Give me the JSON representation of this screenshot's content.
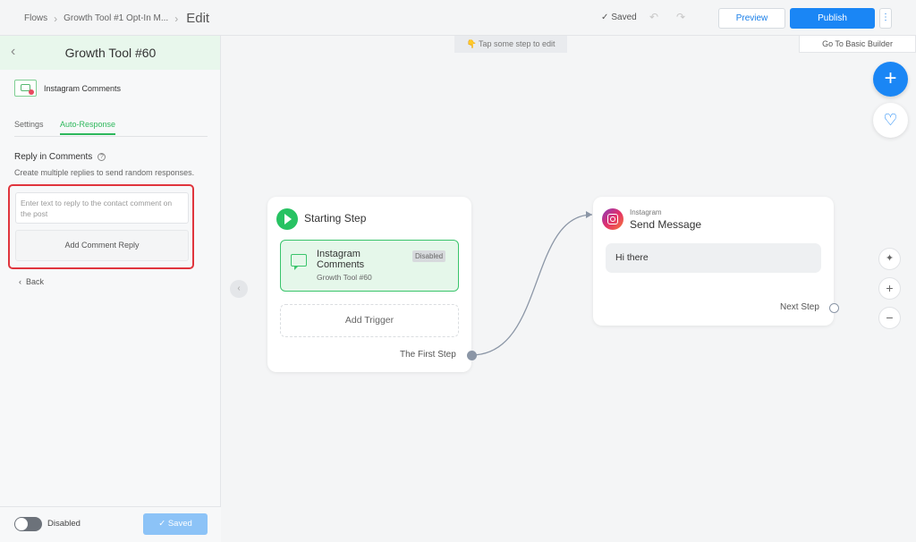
{
  "breadcrumb": {
    "root": "Flows",
    "flow": "Growth Tool #1 Opt-In M...",
    "current": "Edit"
  },
  "toolbar": {
    "saved_status": "Saved",
    "preview_label": "Preview",
    "publish_label": "Publish",
    "more_label": "⋮",
    "basic_builder_label": "Go To Basic Builder"
  },
  "canvas": {
    "hint": "👇 Tap some step to edit"
  },
  "sidebar": {
    "title": "Growth Tool #60",
    "trigger_name": "Instagram Comments",
    "tabs": [
      {
        "label": "Settings",
        "active": false
      },
      {
        "label": "Auto-Response",
        "active": true
      }
    ],
    "reply_title": "Reply in Comments",
    "reply_description": "Create multiple replies to send random responses.",
    "reply_placeholder": "Enter text to reply to the contact comment on the post",
    "add_reply_label": "Add Comment Reply",
    "back_label": "Back",
    "toggle_label": "Disabled",
    "saved_button": "✓ Saved"
  },
  "starting_step": {
    "title": "Starting Step",
    "trigger": {
      "title": "Instagram Comments",
      "subtitle": "Growth Tool #60",
      "badge": "Disabled"
    },
    "add_trigger_label": "Add Trigger",
    "output_label": "The First Step"
  },
  "message_step": {
    "platform": "Instagram",
    "title": "Send Message",
    "message": "Hi there",
    "next_label": "Next Step"
  },
  "colors": {
    "accent_blue": "#1a86f5",
    "accent_green": "#27c262",
    "error_red": "#e0353d"
  }
}
